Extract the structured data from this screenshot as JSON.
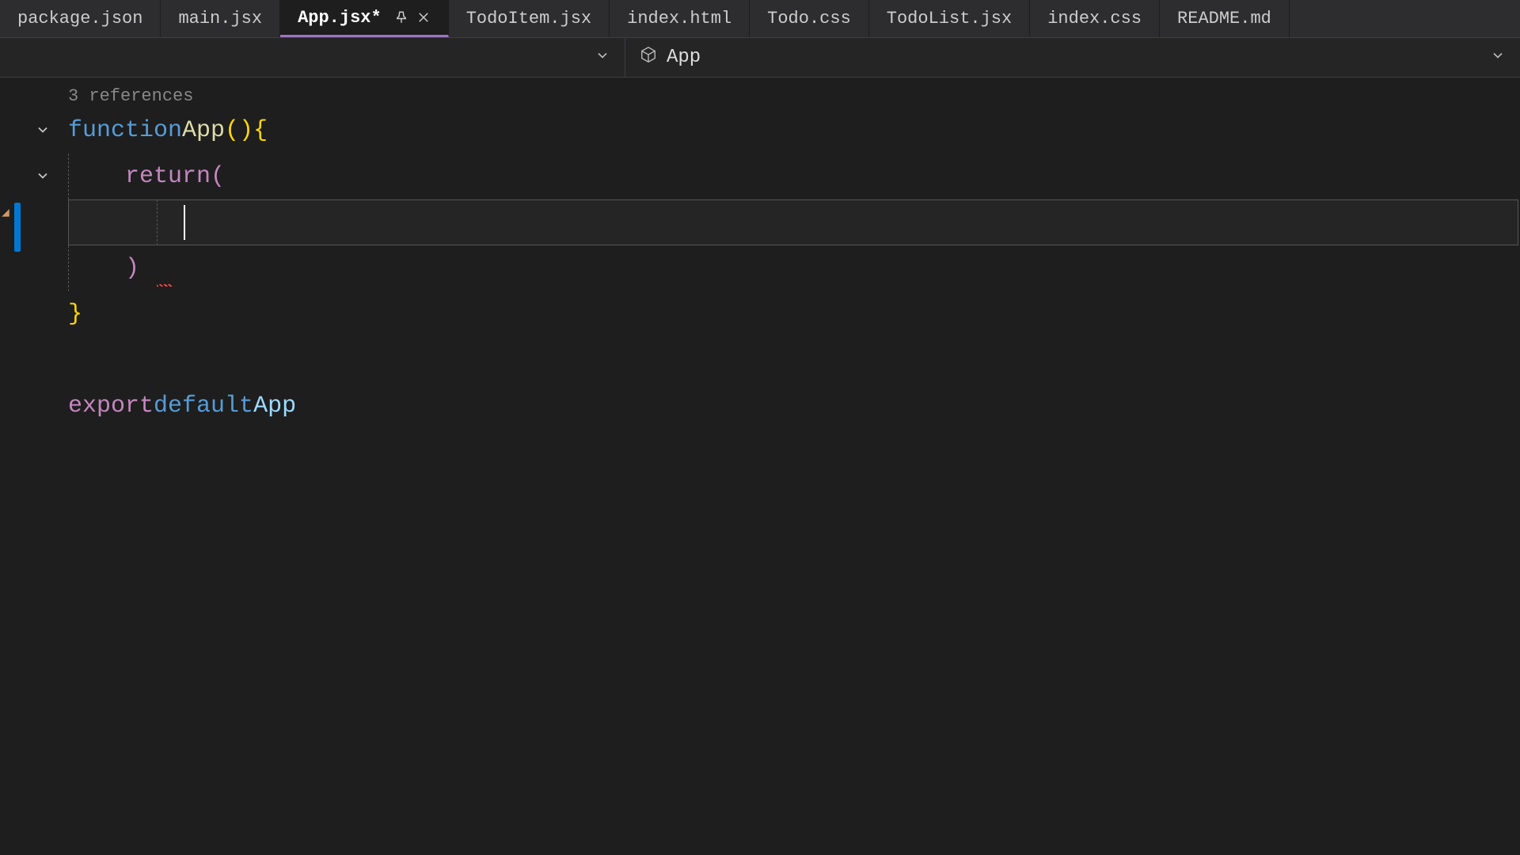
{
  "tabs": [
    {
      "label": "package.json"
    },
    {
      "label": "main.jsx"
    },
    {
      "label": "App.jsx*"
    },
    {
      "label": "TodoItem.jsx"
    },
    {
      "label": "index.html"
    },
    {
      "label": "Todo.css"
    },
    {
      "label": "TodoList.jsx"
    },
    {
      "label": "index.css"
    },
    {
      "label": "README.md"
    }
  ],
  "active_tab_index": 2,
  "breadcrumb": {
    "symbol_name": "App"
  },
  "codelens": {
    "references": "3 references"
  },
  "code": {
    "kw_function": "function",
    "fn_name": "App",
    "parens": "()",
    "brace_open": "{",
    "kw_return": "return",
    "paren_open": "(",
    "paren_close": ")",
    "brace_close": "}",
    "kw_export": "export",
    "kw_default": "default",
    "ident": "App"
  }
}
